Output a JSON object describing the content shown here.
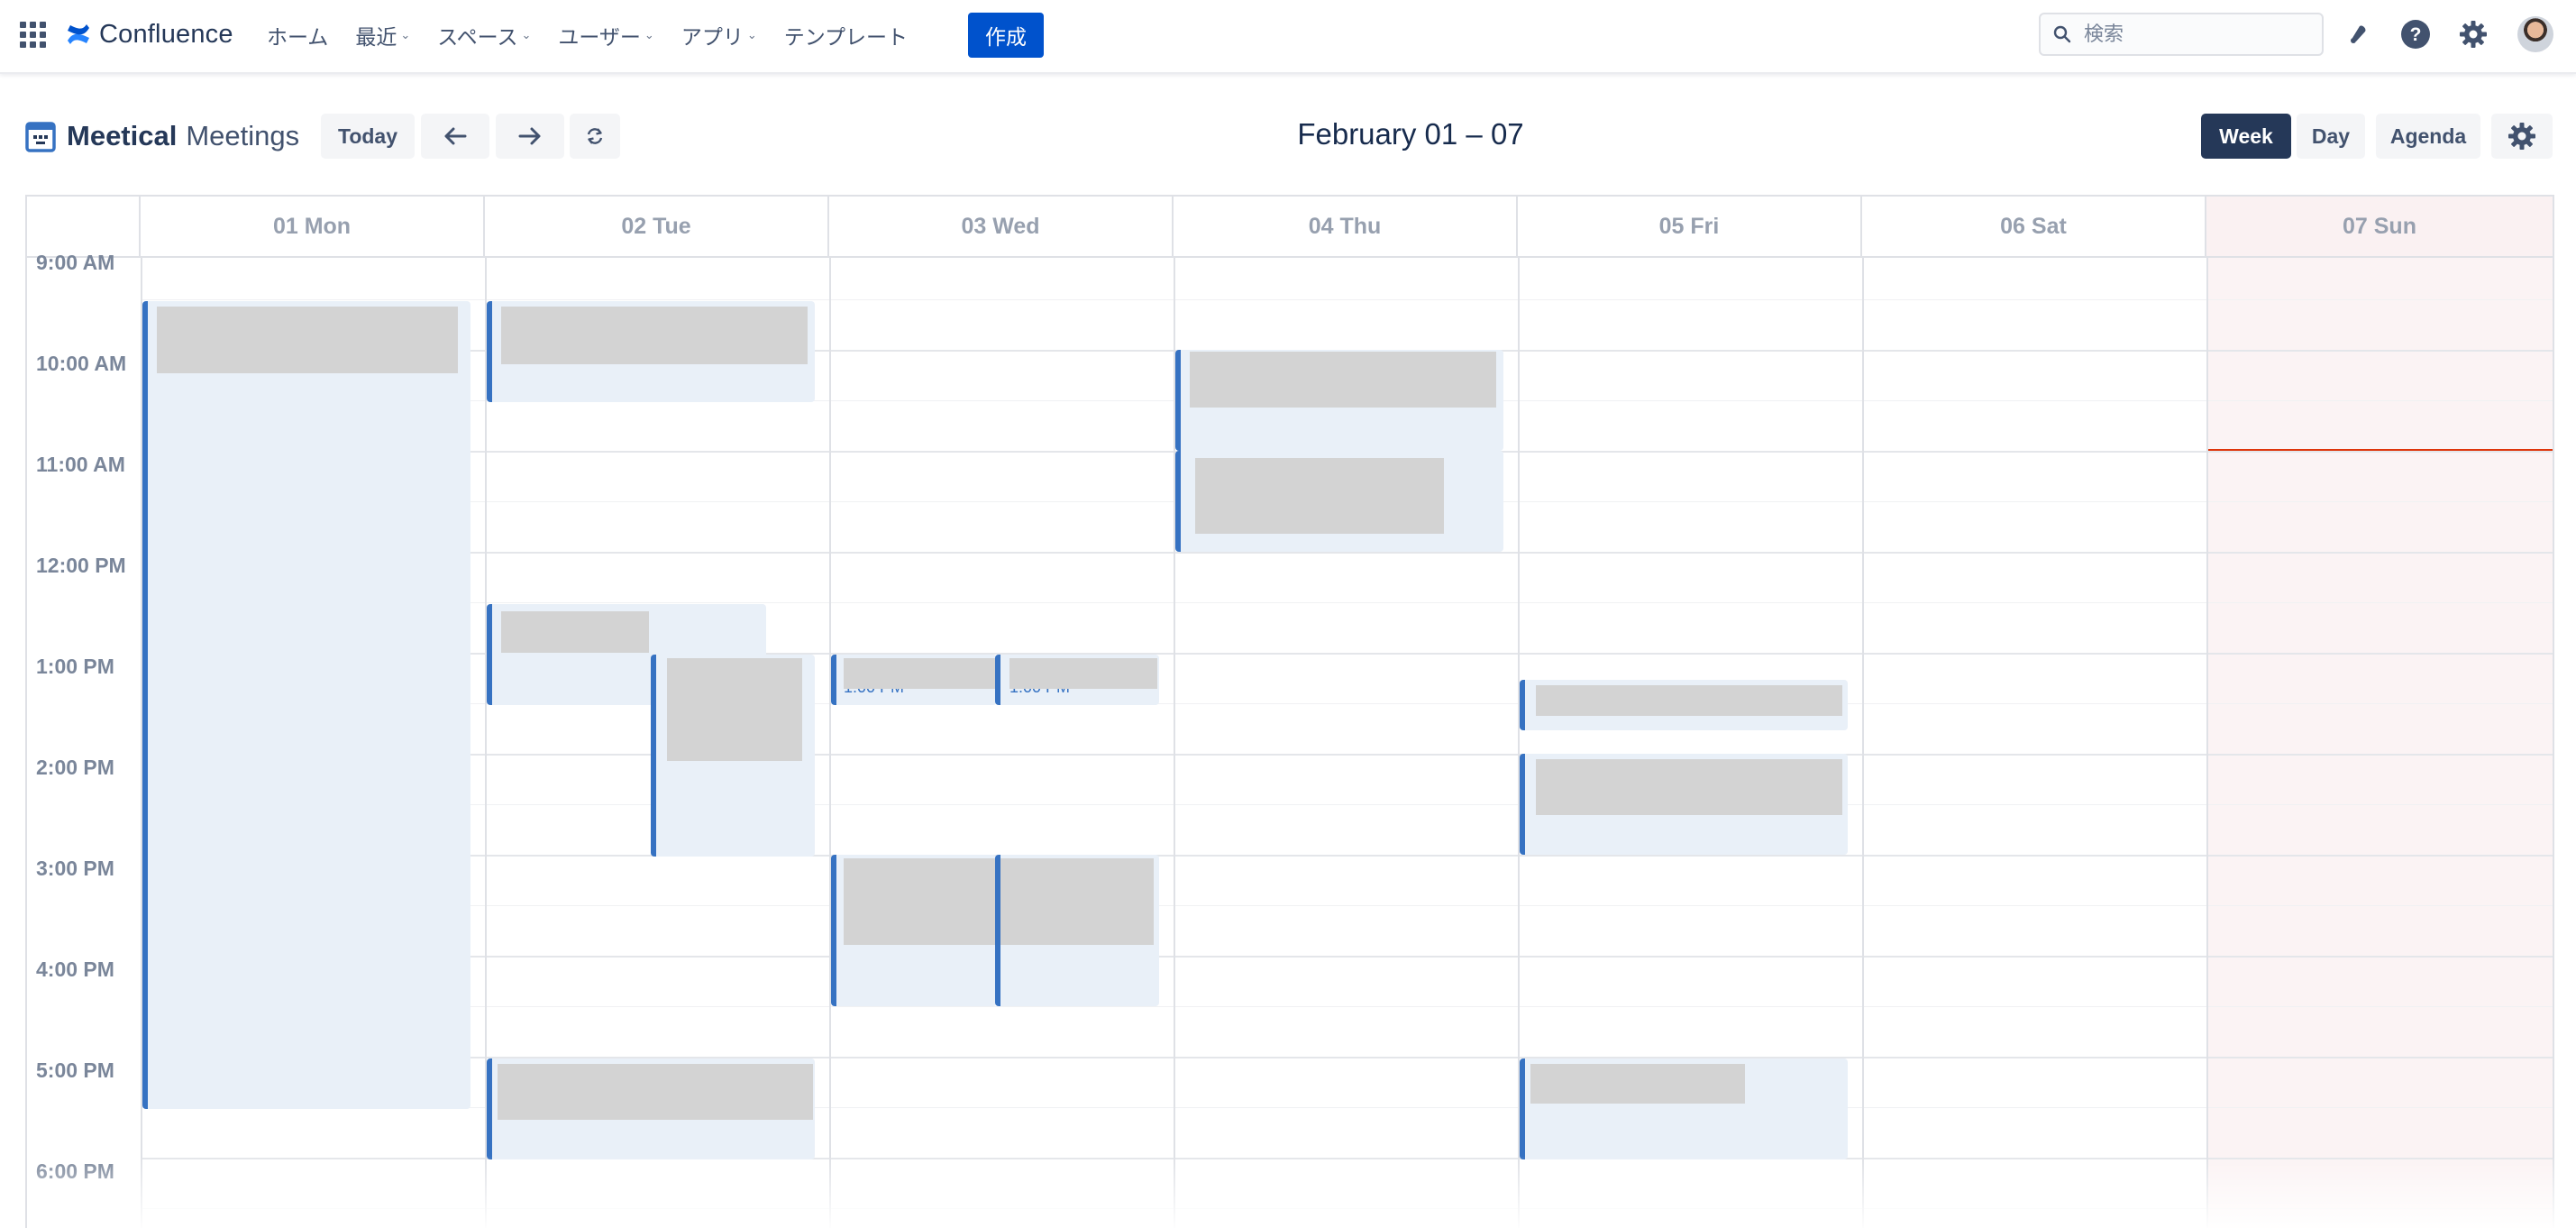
{
  "topnav": {
    "brand": "Confluence",
    "items": [
      {
        "label": "ホーム",
        "dropdown": false
      },
      {
        "label": "最近",
        "dropdown": true
      },
      {
        "label": "スペース",
        "dropdown": true
      },
      {
        "label": "ユーザー",
        "dropdown": true
      },
      {
        "label": "アプリ",
        "dropdown": true
      },
      {
        "label": "テンプレート",
        "dropdown": false
      }
    ],
    "create_label": "作成",
    "search_placeholder": "検索",
    "icons": [
      "notification-bell-icon",
      "help-icon",
      "settings-gear-icon",
      "user-avatar"
    ]
  },
  "toolbar": {
    "app_name": "Meetical",
    "app_sub": "Meetings",
    "today_label": "Today",
    "range_title": "February 01 – 07",
    "views": [
      "Week",
      "Day",
      "Agenda"
    ],
    "active_view": "Week"
  },
  "calendar": {
    "days": [
      "01 Mon",
      "02 Tue",
      "03 Wed",
      "04 Thu",
      "05 Fri",
      "06 Sat",
      "07 Sun"
    ],
    "highlight_day": "07 Sun",
    "times": [
      "9:00 AM",
      "10:00 AM",
      "11:00 AM",
      "12:00 PM",
      "1:00 PM",
      "2:00 PM",
      "3:00 PM",
      "4:00 PM",
      "5:00 PM",
      "6:00 PM"
    ],
    "event_time_labels": {
      "wed_1": "1:00 PM",
      "wed_2": "1:00 PM"
    }
  },
  "colors": {
    "primary": "#0052cc",
    "event_accent": "#3672c2",
    "event_bg": "#e9f0f8",
    "active_view_bg": "#253858",
    "now_line": "#de350b",
    "weekend_highlight": "#fbf3f4"
  }
}
